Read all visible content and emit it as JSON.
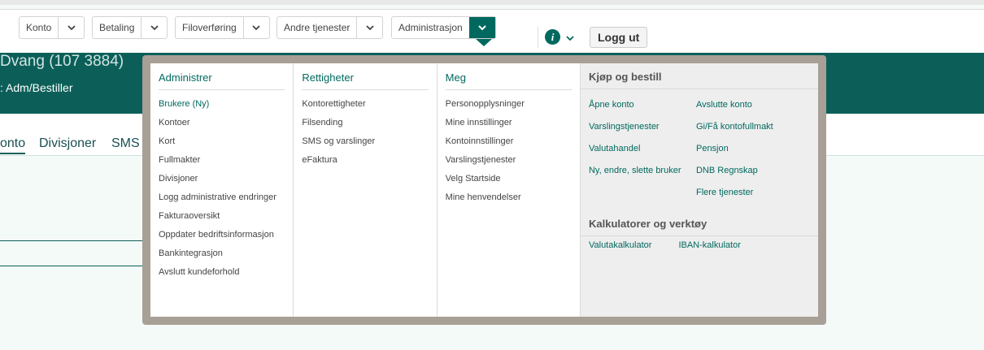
{
  "nav": {
    "items": [
      {
        "label": "Konto"
      },
      {
        "label": "Betaling"
      },
      {
        "label": "Filoverføring"
      },
      {
        "label": "Andre tjenester"
      },
      {
        "label": "Administrasjon"
      }
    ],
    "logout_label": "Logg ut",
    "info_glyph": "i"
  },
  "hero": {
    "name_partial": "Dvang (107 3884)",
    "role": ": Adm/Bestiller"
  },
  "tabs": [
    "onto",
    "Divisjoner",
    "SMS o"
  ],
  "menu": {
    "administrer": {
      "title": "Administrer",
      "items": [
        "Brukere (Ny)",
        "Kontoer",
        "Kort",
        "Fullmakter",
        "Divisjoner",
        "Logg administrative endringer",
        "Fakturaoversikt",
        "Oppdater bedriftsinformasjon",
        "Bankintegrasjon",
        "Avslutt kundeforhold"
      ]
    },
    "rettigheter": {
      "title": "Rettigheter",
      "items": [
        "Kontorettigheter",
        "Filsending",
        "SMS og varslinger",
        "eFaktura"
      ]
    },
    "meg": {
      "title": "Meg",
      "items": [
        "Personopplysninger",
        "Mine innstillinger",
        "Kontoinnstillinger",
        "Varslingstjenester",
        "Velg Startside",
        "Mine henvendelser"
      ]
    },
    "kjop": {
      "title": "Kjøp og bestill",
      "items": [
        "Åpne konto",
        "Avslutte konto",
        "Varslingstjenester",
        "Gi/Få kontofullmakt",
        "Valutahandel",
        "Pensjon",
        "Ny, endre, slette bruker",
        "DNB Regnskap",
        "",
        "Flere tjenester"
      ]
    },
    "kalk": {
      "title": "Kalkulatorer og verktøy",
      "items": [
        "Valutakalkulator",
        "IBAN-kalkulator"
      ]
    }
  },
  "colors": {
    "brand": "#0c5f59",
    "accent": "#00695f",
    "frame": "#a89f96"
  }
}
